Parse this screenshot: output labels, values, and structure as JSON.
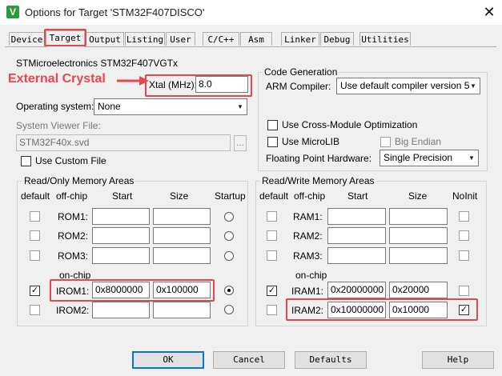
{
  "window": {
    "title": "Options for Target 'STM32F407DISCO'",
    "close_glyph": "✕"
  },
  "tabs": [
    {
      "label": "Device"
    },
    {
      "label": "Target"
    },
    {
      "label": "Output"
    },
    {
      "label": "Listing"
    },
    {
      "label": "User"
    },
    {
      "label": "C/C++"
    },
    {
      "label": "Asm"
    },
    {
      "label": "Linker"
    },
    {
      "label": "Debug"
    },
    {
      "label": "Utilities"
    }
  ],
  "annotation": {
    "text": "External Crystal",
    "color": "#e4474f"
  },
  "target": {
    "device_name": "STMicroelectronics STM32F407VGTx",
    "xtal_label": "Xtal (MHz):",
    "xtal_value": "8.0",
    "os_label": "Operating system:",
    "os_value": "None",
    "svd_label": "System Viewer File:",
    "svd_value": "STM32F40x.svd",
    "svd_browse": "...",
    "custom_file_label": "Use Custom File"
  },
  "code_generation": {
    "title": "Code Generation",
    "compiler_label": "ARM Compiler:",
    "compiler_value": "Use default compiler version 5",
    "cross_module_label": "Use Cross-Module Optimization",
    "microlib_label": "Use MicroLIB",
    "big_endian_label": "Big Endian",
    "fpu_label": "Floating Point Hardware:",
    "fpu_value": "Single Precision"
  },
  "ro_memory": {
    "title": "Read/Only Memory Areas",
    "headers": {
      "default": "default",
      "offchip": "off-chip",
      "start": "Start",
      "size": "Size",
      "extra": "Startup"
    },
    "onchip_label": "on-chip",
    "rows": [
      {
        "name": "ROM1:",
        "default": false,
        "start": "",
        "size": "",
        "selected": false
      },
      {
        "name": "ROM2:",
        "default": false,
        "start": "",
        "size": "",
        "selected": false
      },
      {
        "name": "ROM3:",
        "default": false,
        "start": "",
        "size": "",
        "selected": false
      },
      {
        "name": "IROM1:",
        "default": true,
        "start": "0x8000000",
        "size": "0x100000",
        "selected": true
      },
      {
        "name": "IROM2:",
        "default": false,
        "start": "",
        "size": "",
        "selected": false
      }
    ]
  },
  "rw_memory": {
    "title": "Read/Write Memory Areas",
    "headers": {
      "default": "default",
      "offchip": "off-chip",
      "start": "Start",
      "size": "Size",
      "extra": "NoInit"
    },
    "onchip_label": "on-chip",
    "rows": [
      {
        "name": "RAM1:",
        "default": false,
        "start": "",
        "size": "",
        "noinit": false
      },
      {
        "name": "RAM2:",
        "default": false,
        "start": "",
        "size": "",
        "noinit": false
      },
      {
        "name": "RAM3:",
        "default": false,
        "start": "",
        "size": "",
        "noinit": false
      },
      {
        "name": "IRAM1:",
        "default": true,
        "start": "0x20000000",
        "size": "0x20000",
        "noinit": false
      },
      {
        "name": "IRAM2:",
        "default": false,
        "start": "0x10000000",
        "size": "0x10000",
        "noinit": true
      }
    ]
  },
  "buttons": {
    "ok": "OK",
    "cancel": "Cancel",
    "defaults": "Defaults",
    "help": "Help"
  }
}
